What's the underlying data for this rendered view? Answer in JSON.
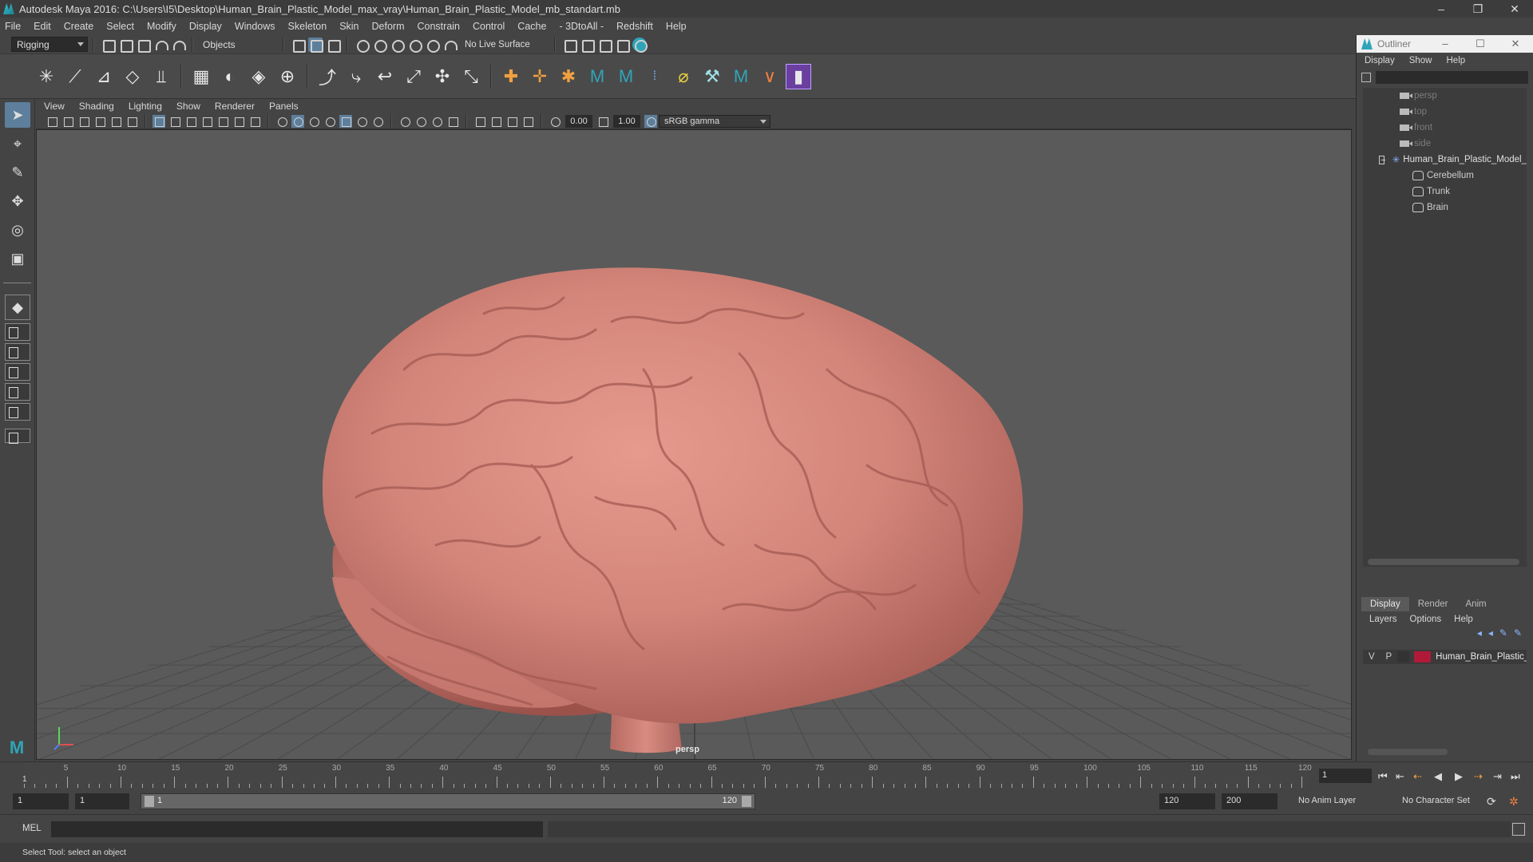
{
  "window": {
    "title": "Autodesk Maya 2016: C:\\Users\\I5\\Desktop\\Human_Brain_Plastic_Model_max_vray\\Human_Brain_Plastic_Model_mb_standart.mb",
    "min": "–",
    "restore": "❐",
    "close": "✕"
  },
  "menubar": {
    "items": [
      "File",
      "Edit",
      "Create",
      "Select",
      "Modify",
      "Display",
      "Windows",
      "Skeleton",
      "Skin",
      "Deform",
      "Constrain",
      "Control",
      "Cache",
      "- 3DtoAll -",
      "Redshift",
      "Help"
    ]
  },
  "statusline": {
    "mode": "Rigging",
    "selection_mode": "Objects",
    "live_surface": "No Live Surface"
  },
  "viewport": {
    "menu": [
      "View",
      "Shading",
      "Lighting",
      "Show",
      "Renderer",
      "Panels"
    ],
    "exposure": "0.00",
    "gamma": "1.00",
    "color_space": "sRGB gamma",
    "camera_label": "persp"
  },
  "outliner": {
    "title": "Outliner",
    "min": "–",
    "max": "☐",
    "close": "✕",
    "menu": [
      "Display",
      "Show",
      "Help"
    ],
    "cameras": [
      "persp",
      "top",
      "front",
      "side"
    ],
    "root": "Human_Brain_Plastic_Model_",
    "children": [
      "Cerebellum",
      "Trunk",
      "Brain"
    ]
  },
  "layers": {
    "tabs": [
      "Display",
      "Render",
      "Anim"
    ],
    "menu": [
      "Layers",
      "Options",
      "Help"
    ],
    "row": {
      "v": "V",
      "p": "P",
      "name": "Human_Brain_Plastic_M",
      "color": "#b01a38"
    }
  },
  "timeline": {
    "labels": [
      "5",
      "10",
      "15",
      "20",
      "25",
      "30",
      "35",
      "40",
      "45",
      "50",
      "55",
      "60",
      "65",
      "70",
      "75",
      "80",
      "85",
      "90",
      "95",
      "100",
      "105",
      "110",
      "115",
      "120"
    ],
    "start_marker": "1",
    "current_frame": "1"
  },
  "range": {
    "start": "1",
    "playback_start": "1",
    "slider_start": "1",
    "slider_end": "120",
    "playback_end": "120",
    "end": "200",
    "anim_layer": "No Anim Layer",
    "char_set": "No Character Set"
  },
  "cmd": {
    "lang": "MEL"
  },
  "help": {
    "text": "Select Tool: select an object"
  }
}
